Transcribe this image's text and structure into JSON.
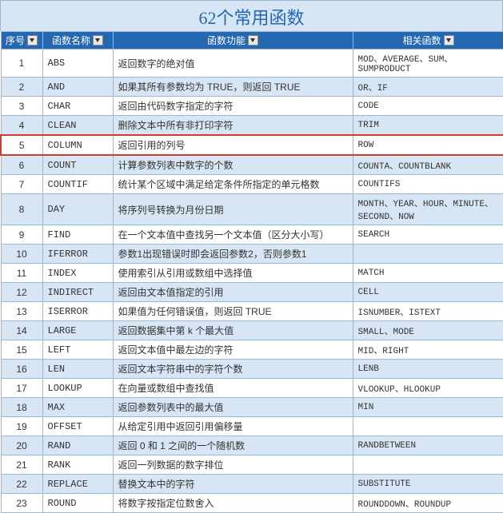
{
  "title": "62个常用函数",
  "headers": {
    "seq": "序号",
    "name": "函数名称",
    "func": "函数功能",
    "rel": "相关函数"
  },
  "highlight_index": 4,
  "rows": [
    {
      "seq": "1",
      "name": "ABS",
      "func": "返回数字的绝对值",
      "rel": "MOD、AVERAGE、SUM、SUMPRODUCT"
    },
    {
      "seq": "2",
      "name": "AND",
      "func": "如果其所有参数均为 TRUE，则返回 TRUE",
      "rel": "OR、IF"
    },
    {
      "seq": "3",
      "name": "CHAR",
      "func": "返回由代码数字指定的字符",
      "rel": "CODE"
    },
    {
      "seq": "4",
      "name": "CLEAN",
      "func": "删除文本中所有非打印字符",
      "rel": "TRIM"
    },
    {
      "seq": "5",
      "name": "COLUMN",
      "func": "返回引用的列号",
      "rel": "ROW"
    },
    {
      "seq": "6",
      "name": "COUNT",
      "func": "计算参数列表中数字的个数",
      "rel": "COUNTA、COUNTBLANK"
    },
    {
      "seq": "7",
      "name": "COUNTIF",
      "func": "统计某个区域中满足给定条件所指定的单元格数",
      "rel": "COUNTIFS"
    },
    {
      "seq": "8",
      "name": "DAY",
      "func": "将序列号转换为月份日期",
      "rel": "MONTH、YEAR、HOUR、MINUTE、SECOND、NOW"
    },
    {
      "seq": "9",
      "name": "FIND",
      "func": "在一个文本值中查找另一个文本值（区分大小写）",
      "rel": "SEARCH"
    },
    {
      "seq": "10",
      "name": "IFERROR",
      "func": "参数1出现错误时即会返回参数2，否则参数1",
      "rel": ""
    },
    {
      "seq": "11",
      "name": "INDEX",
      "func": "使用索引从引用或数组中选择值",
      "rel": "MATCH"
    },
    {
      "seq": "12",
      "name": "INDIRECT",
      "func": "返回由文本值指定的引用",
      "rel": "CELL"
    },
    {
      "seq": "13",
      "name": "ISERROR",
      "func": "如果值为任何错误值，则返回 TRUE",
      "rel": "ISNUMBER、ISTEXT"
    },
    {
      "seq": "14",
      "name": "LARGE",
      "func": "返回数据集中第 k 个最大值",
      "rel": "SMALL、MODE"
    },
    {
      "seq": "15",
      "name": "LEFT",
      "func": "返回文本值中最左边的字符",
      "rel": "MID、RIGHT"
    },
    {
      "seq": "16",
      "name": "LEN",
      "func": "返回文本字符串中的字符个数",
      "rel": "LENB"
    },
    {
      "seq": "17",
      "name": "LOOKUP",
      "func": "在向量或数组中查找值",
      "rel": "VLOOKUP、HLOOKUP"
    },
    {
      "seq": "18",
      "name": "MAX",
      "func": "返回参数列表中的最大值",
      "rel": "MIN"
    },
    {
      "seq": "19",
      "name": "OFFSET",
      "func": "从给定引用中返回引用偏移量",
      "rel": ""
    },
    {
      "seq": "20",
      "name": "RAND",
      "func": "返回 0 和 1 之间的一个随机数",
      "rel": "RANDBETWEEN"
    },
    {
      "seq": "21",
      "name": "RANK",
      "func": "返回一列数据的数字排位",
      "rel": ""
    },
    {
      "seq": "22",
      "name": "REPLACE",
      "func": "替换文本中的字符",
      "rel": "SUBSTITUTE"
    },
    {
      "seq": "23",
      "name": "ROUND",
      "func": "将数字按指定位数舍入",
      "rel": "ROUNDDOWN、ROUNDUP"
    }
  ]
}
